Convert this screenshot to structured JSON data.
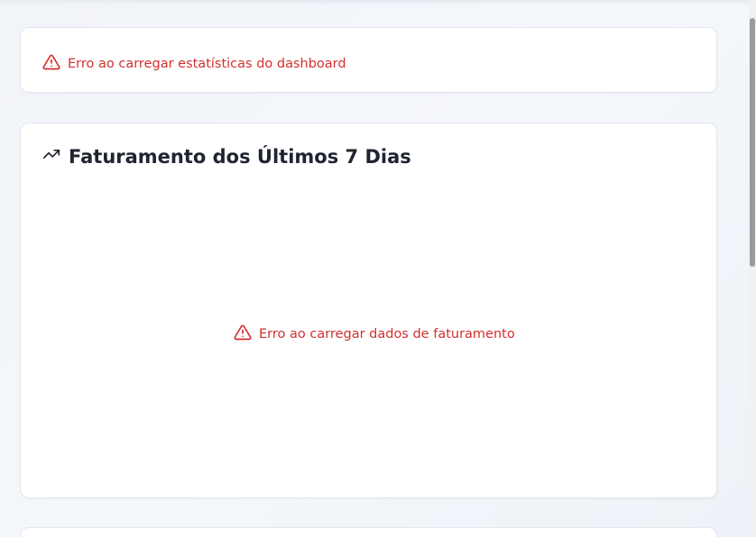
{
  "stats_error": {
    "icon": "alert-triangle-icon",
    "message": "Erro ao carregar estatísticas do dashboard",
    "color": "#d32f2f"
  },
  "revenue_card": {
    "icon": "trending-up-icon",
    "title": "Faturamento dos Últimos 7 Dias",
    "error_icon": "alert-triangle-icon",
    "error_message": "Erro ao carregar dados de faturamento"
  }
}
